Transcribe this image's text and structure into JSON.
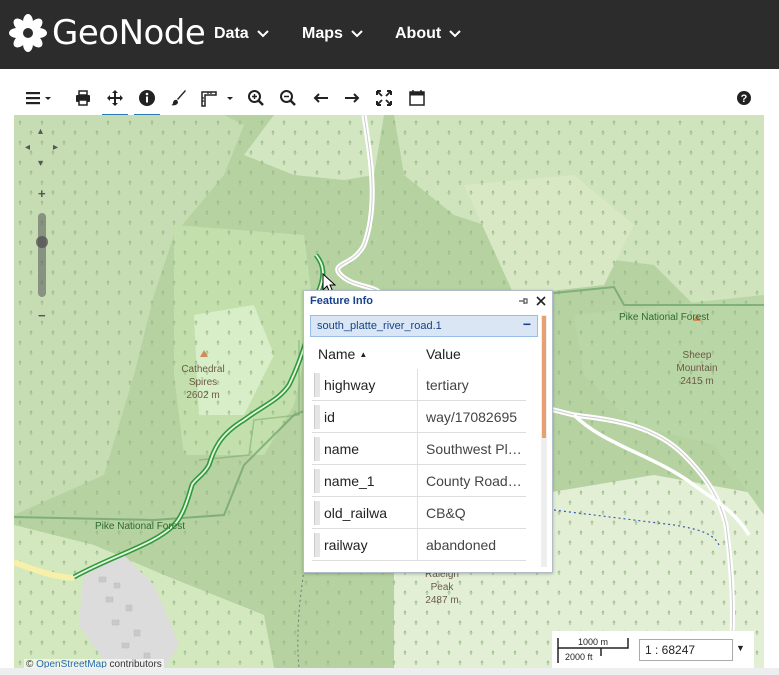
{
  "header": {
    "logo_text": "GeoNode",
    "nav": [
      {
        "label": "Data"
      },
      {
        "label": "Maps"
      },
      {
        "label": "About"
      }
    ]
  },
  "toolbar": {
    "icons": [
      "menu-icon",
      "print-icon",
      "pan-icon",
      "info-icon",
      "paint-brush-icon",
      "measure-icon",
      "zoom-in-icon",
      "zoom-out-icon",
      "back-icon",
      "forward-icon",
      "full-extent-icon",
      "calendar-icon",
      "help-icon"
    ],
    "active": [
      "pan-icon",
      "info-icon"
    ],
    "accent": "#2a7ab0"
  },
  "map": {
    "labels": {
      "cathedral_spires": [
        "Cathedral",
        "Spires",
        "2602 m"
      ],
      "sheep_mountain": [
        "Sheep",
        "Mountain",
        "2415 m"
      ],
      "raleigh_peak": [
        "Raleigh",
        "Peak",
        "2487 m"
      ],
      "pike_forest_left": "Pike National Forest",
      "pike_forest_right": "Pike National Forest"
    }
  },
  "feature_info": {
    "title": "Feature Info",
    "layer": "south_platte_river_road.1",
    "col_name": "Name",
    "col_value": "Value",
    "rows": [
      {
        "key": "highway",
        "value": "tertiary"
      },
      {
        "key": "id",
        "value": "way/17082695"
      },
      {
        "key": "name",
        "value": "Southwest Pl…"
      },
      {
        "key": "name_1",
        "value": "County Road…"
      },
      {
        "key": "old_railwa",
        "value": "CB&Q"
      },
      {
        "key": "railway",
        "value": "abandoned"
      }
    ]
  },
  "scale": {
    "metric": "1000 m",
    "imperial": "2000 ft",
    "ratio": "1 : 68247"
  },
  "attribution": {
    "prefix": "© ",
    "link": "OpenStreetMap",
    "suffix": " contributors"
  }
}
